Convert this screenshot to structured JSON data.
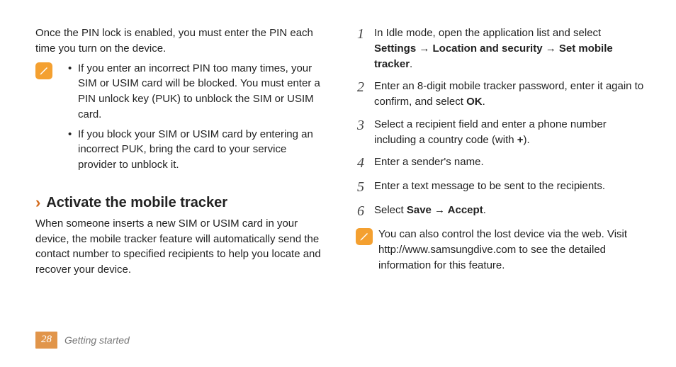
{
  "left": {
    "intro": "Once the PIN lock is enabled, you must enter the PIN each time you turn on the device.",
    "note_bullets": [
      "If you enter an incorrect PIN too many times, your SIM or USIM card will be blocked. You must enter a PIN unlock key (PUK) to unblock the SIM or USIM card.",
      "If you block your SIM or USIM card by entering an incorrect PUK, bring the card to your service provider to unblock it."
    ],
    "heading": "Activate the mobile tracker",
    "heading_para": "When someone inserts a new SIM or USIM card in your device, the mobile tracker feature will automatically send the contact number to specified recipients to help you locate and recover your device."
  },
  "right": {
    "steps": [
      {
        "num": "1",
        "pre": "In Idle mode, open the application list and select ",
        "bold": "Settings → Location and security → Set mobile tracker",
        "post": "."
      },
      {
        "num": "2",
        "pre": "Enter an 8-digit mobile tracker password, enter it again to confirm, and select ",
        "bold": "OK",
        "post": "."
      },
      {
        "num": "3",
        "pre": "Select a recipient field and enter a phone number including a country code (with ",
        "bold": "+",
        "post": ")."
      },
      {
        "num": "4",
        "pre": "Enter a sender's name.",
        "bold": "",
        "post": ""
      },
      {
        "num": "5",
        "pre": "Enter a text message to be sent to the recipients.",
        "bold": "",
        "post": ""
      },
      {
        "num": "6",
        "pre": "Select ",
        "bold": "Save → Accept",
        "post": "."
      }
    ],
    "note": "You can also control the lost device via the web. Visit http://www.samsungdive.com to see the detailed information for this feature."
  },
  "footer": {
    "page_num": "28",
    "section": "Getting started"
  },
  "chevron": "›"
}
